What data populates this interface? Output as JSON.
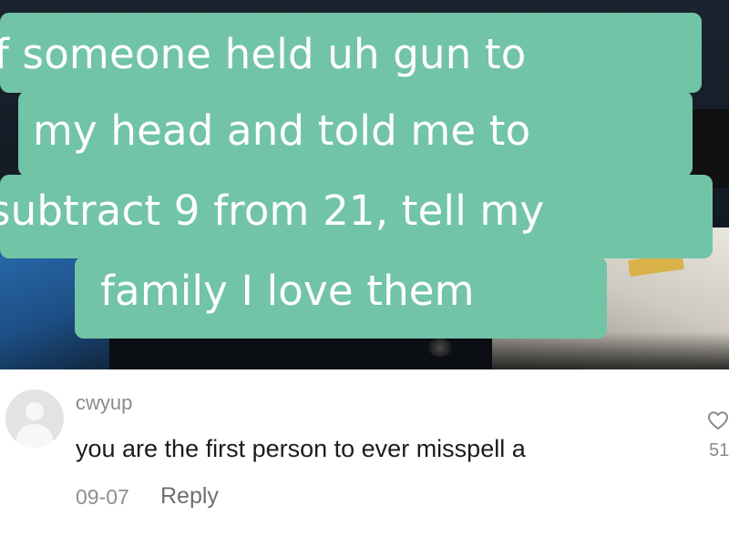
{
  "video": {
    "caption_lines": [
      "f someone held uh gun to",
      "my head and told me to",
      "subtract 9 from 21, tell my",
      "family I love them"
    ],
    "caption_color": "#72c4a6"
  },
  "comment": {
    "username": "cwyup",
    "text": "you are the first person to ever misspell a",
    "date": "09-07",
    "reply_label": "Reply",
    "like_count": "51",
    "like_icon": "heart-outline-icon",
    "avatar_icon": "default-avatar-icon"
  }
}
